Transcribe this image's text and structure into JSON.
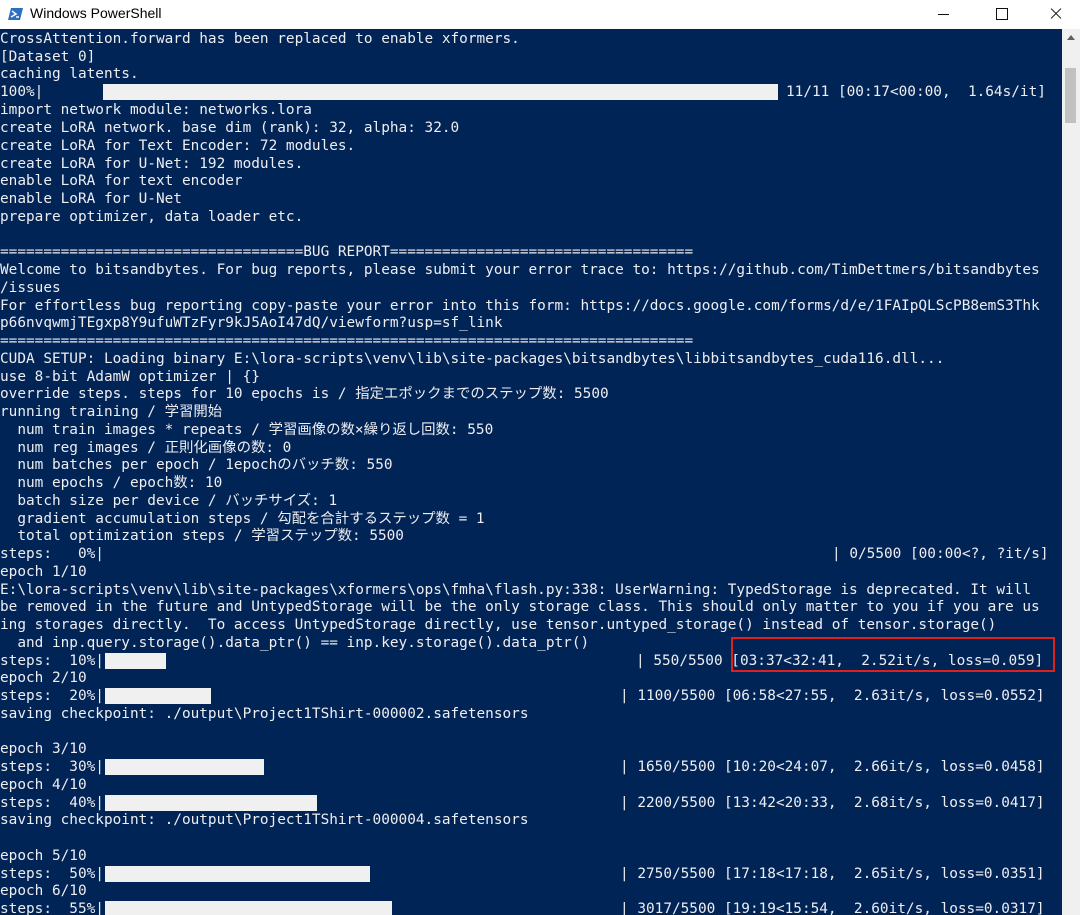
{
  "window": {
    "title": "Windows PowerShell",
    "icon": "powershell-icon"
  },
  "colors": {
    "console_bg": "#012456",
    "console_fg": "#eeedf0",
    "progress_fill": "#f0f0f0",
    "highlight_border": "#e0201f"
  },
  "lines": [
    "CrossAttention.forward has been replaced to enable xformers.",
    "[Dataset 0]",
    "caching latents.",
    "100%|",
    "import network module: networks.lora",
    "create LoRA network. base dim (rank): 32, alpha: 32.0",
    "create LoRA for Text Encoder: 72 modules.",
    "create LoRA for U-Net: 192 modules.",
    "enable LoRA for text encoder",
    "enable LoRA for U-Net",
    "prepare optimizer, data loader etc.",
    "",
    "===================================BUG REPORT===================================",
    "Welcome to bitsandbytes. For bug reports, please submit your error trace to: https://github.com/TimDettmers/bitsandbytes",
    "/issues",
    "For effortless bug reporting copy-paste your error into this form: https://docs.google.com/forms/d/e/1FAIpQLScPB8emS3Thk",
    "p66nvqwmjTEgxp8Y9ufuWTzFyr9kJ5AoI47dQ/viewform?usp=sf_link",
    "================================================================================",
    "CUDA SETUP: Loading binary E:\\lora-scripts\\venv\\lib\\site-packages\\bitsandbytes\\libbitsandbytes_cuda116.dll...",
    "use 8-bit AdamW optimizer | {}",
    "override steps. steps for 10 epochs is / 指定エポックまでのステップ数: 5500",
    "running training / 学習開始",
    "  num train images * repeats / 学習画像の数×繰り返し回数: 550",
    "  num reg images / 正則化画像の数: 0",
    "  num batches per epoch / 1epochのバッチ数: 550",
    "  num epochs / epoch数: 10",
    "  batch size per device / バッチサイズ: 1",
    "  gradient accumulation steps / 勾配を合計するステップ数 = 1",
    "  total optimization steps / 学習ステップ数: 5500",
    "steps:   0%|",
    "epoch 1/10",
    "E:\\lora-scripts\\venv\\lib\\site-packages\\xformers\\ops\\fmha\\flash.py:338: UserWarning: TypedStorage is deprecated. It will",
    "be removed in the future and UntypedStorage will be the only storage class. This should only matter to you if you are us",
    "ing storages directly.  To access UntypedStorage directly, use tensor.untyped_storage() instead of tensor.storage()",
    "  and inp.query.storage().data_ptr() == inp.key.storage().data_ptr()",
    "steps:  10%|",
    "epoch 2/10",
    "steps:  20%|",
    "saving checkpoint: ./output\\Project1TShirt-000002.safetensors",
    "",
    "epoch 3/10",
    "steps:  30%|",
    "epoch 4/10",
    "steps:  40%|",
    "saving checkpoint: ./output\\Project1TShirt-000004.safetensors",
    "",
    "epoch 5/10",
    "steps:  50%|",
    "epoch 6/10",
    "steps:  55%|"
  ],
  "progress_rows": [
    {
      "fraction": 1.0,
      "tail": "11/11 [00:17<00:00,  1.64s/it]"
    },
    {
      "fraction": 0.0,
      "tail": "| 0/5500 [00:00<?, ?it/s]"
    },
    {
      "fraction": 0.1,
      "tail": "| 550/5500 [03:37<32:41,  2.52it/s, loss=0.059]"
    },
    {
      "fraction": 0.2,
      "tail": "| 1100/5500 [06:58<27:55,  2.63it/s, loss=0.0552]"
    },
    {
      "fraction": 0.3,
      "tail": "| 1650/5500 [10:20<24:07,  2.66it/s, loss=0.0458]"
    },
    {
      "fraction": 0.4,
      "tail": "| 2200/5500 [13:42<20:33,  2.68it/s, loss=0.0417]"
    },
    {
      "fraction": 0.5,
      "tail": "| 2750/5500 [17:18<17:18,  2.65it/s, loss=0.0351]"
    },
    {
      "fraction": 0.55,
      "tail": "| 3017/5500 [19:19<15:54,  2.60it/s, loss=0.0317]"
    }
  ]
}
